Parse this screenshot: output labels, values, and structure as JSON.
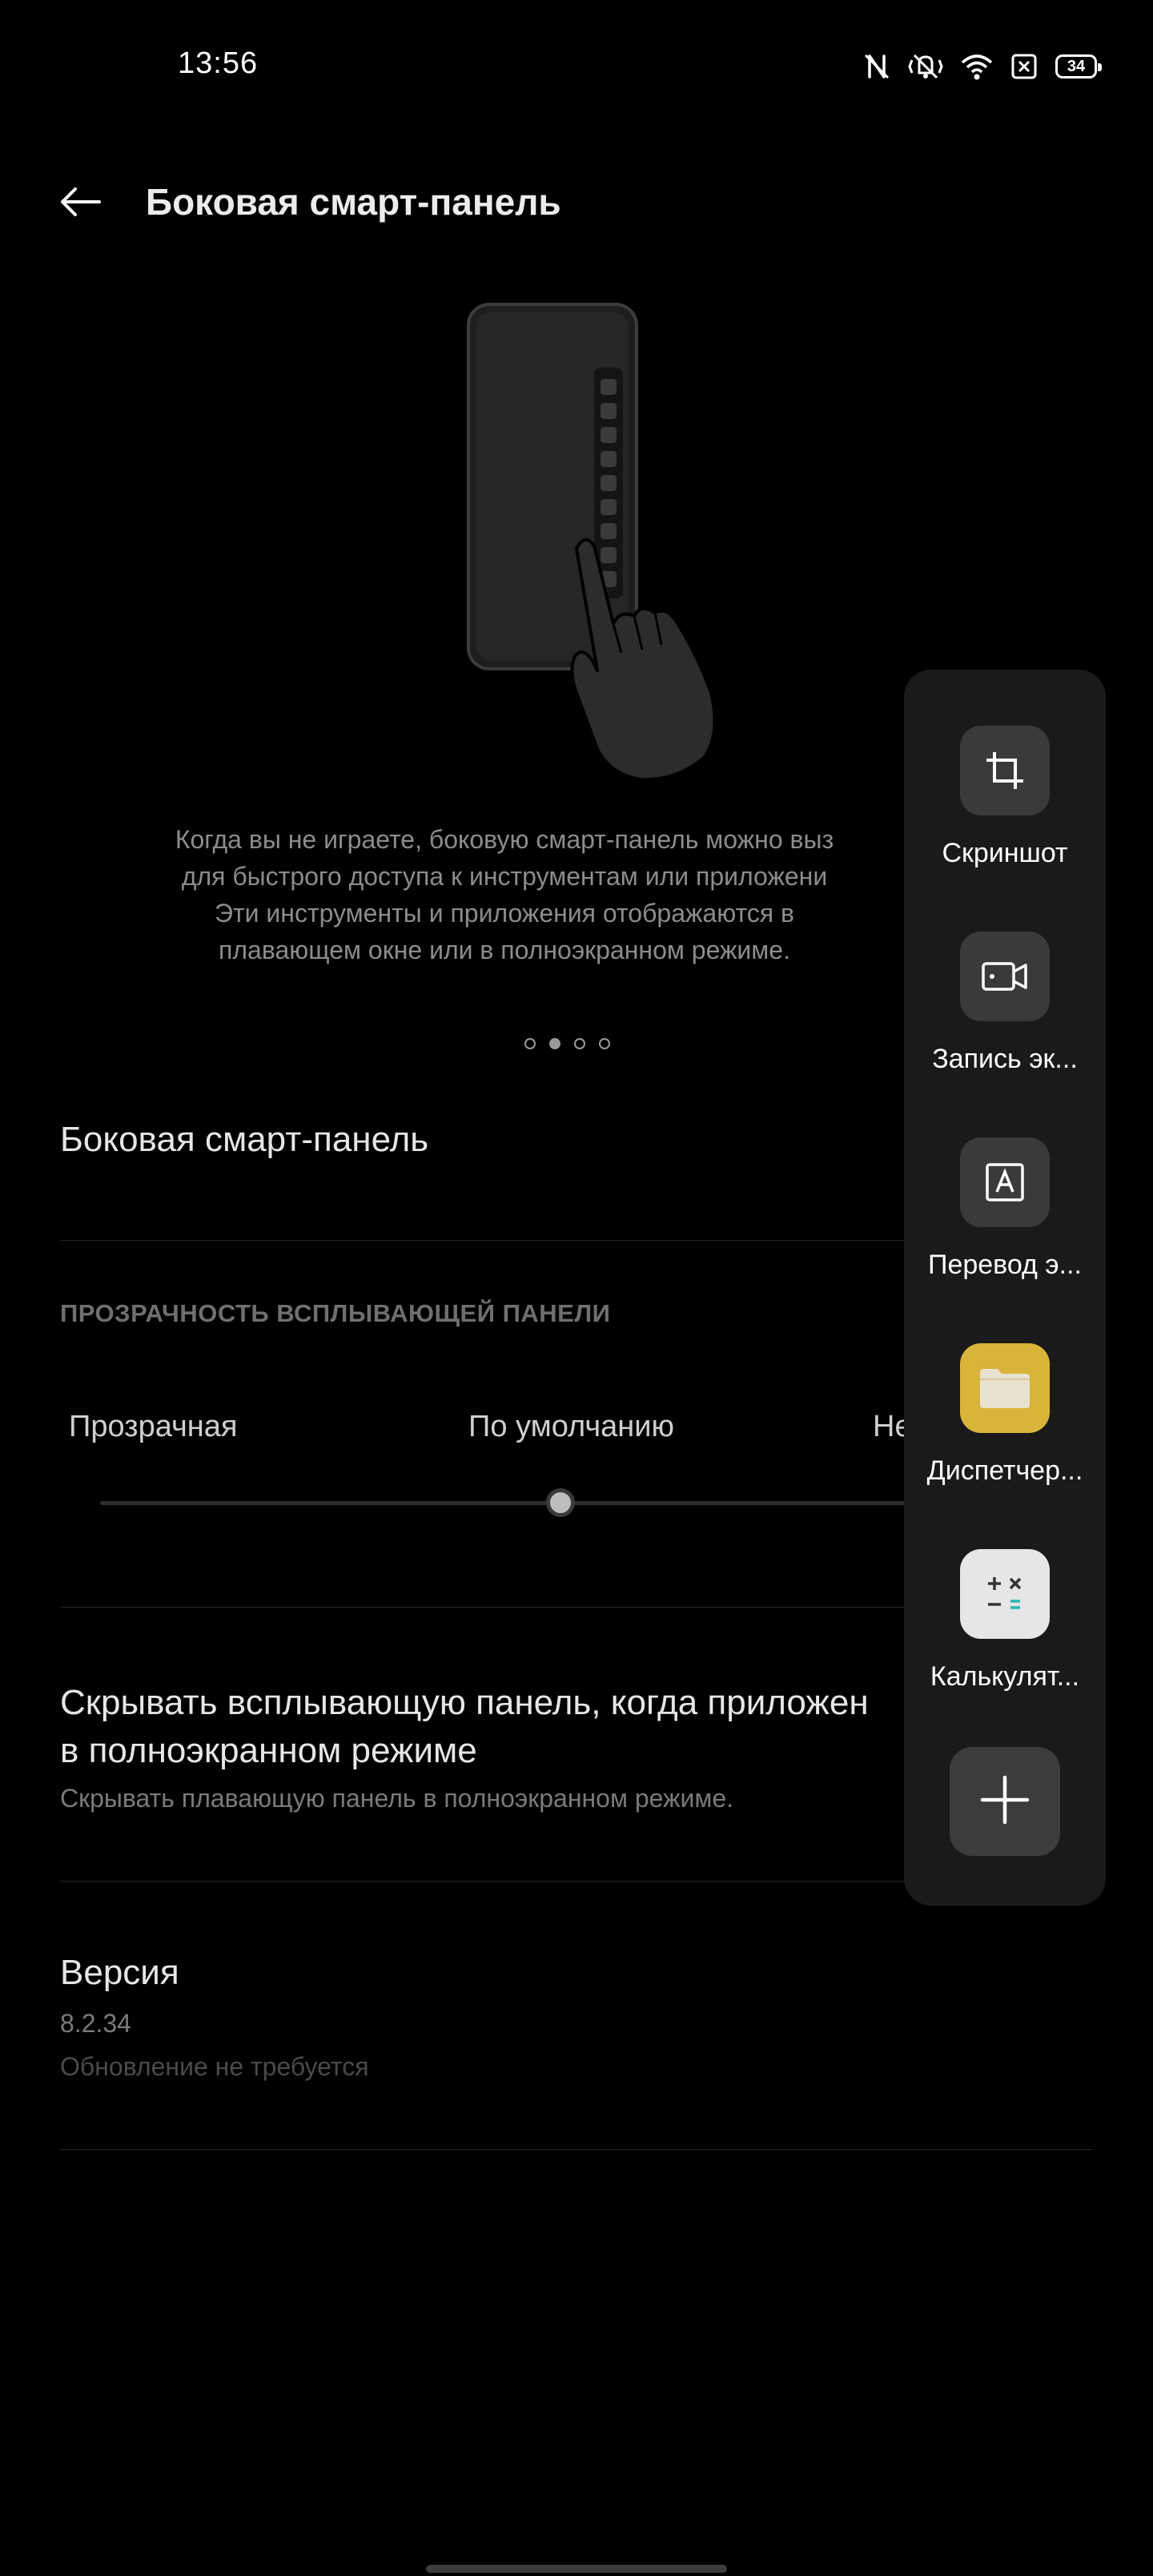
{
  "status_bar": {
    "time": "13:56",
    "battery": "34",
    "icons": [
      "nfc-icon",
      "mute-vibrate-icon",
      "wifi-icon",
      "sim-x-icon",
      "battery-icon"
    ]
  },
  "header": {
    "back_icon": "arrow-left-icon",
    "title": "Боковая смарт-панель"
  },
  "illustration": {
    "description_lines": [
      "Когда вы не играете, боковую смарт-панель можно выз",
      "для быстрого доступа к инструментам или приложени",
      "Эти инструменты и приложения отображаются в",
      "плавающем окне или в полноэкранном режиме."
    ],
    "page_count": 4,
    "active_page": 2
  },
  "settings": {
    "toggle_row_title": "Боковая смарт-панель",
    "transparency_section": "ПРОЗРАЧНОСТЬ ВСПЛЫВАЮЩЕЙ ПАНЕЛИ",
    "transparency_options": [
      "Прозрачная",
      "По умолчанию",
      "Не"
    ],
    "transparency_value": 0.5,
    "hide_row": {
      "title_line1": "Скрывать всплывающую панель, когда приложен",
      "title_line2": "в полноэкранном режиме",
      "subtitle": "Скрывать плавающую панель в полноэкранном режиме."
    },
    "version": {
      "title": "Версия",
      "value": "8.2.34",
      "note": "Обновление не требуется"
    }
  },
  "smart_panel": {
    "items": [
      {
        "label": "Скриншот",
        "icon": "crop-icon"
      },
      {
        "label": "Запись эк...",
        "icon": "screen-record-icon"
      },
      {
        "label": "Перевод э...",
        "icon": "translate-icon"
      },
      {
        "label": "Диспетчер...",
        "icon": "folder-icon"
      },
      {
        "label": "Калькулят...",
        "icon": "calculator-icon"
      }
    ],
    "add_icon": "plus-icon"
  },
  "colors": {
    "background": "#000000",
    "panel": "#1a1a1a",
    "files_icon": "#d9b43a",
    "calculator_icon": "#e6e6e6",
    "calculator_equals": "#2bb5b0"
  }
}
